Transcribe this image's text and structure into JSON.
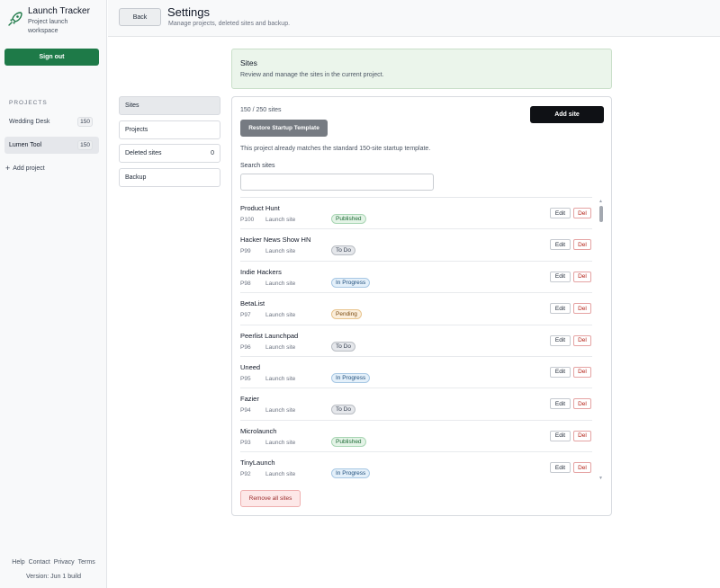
{
  "app": {
    "title": "Launch Tracker",
    "subtitle_line1": "Project launch",
    "subtitle_line2": "workspace",
    "logo_icon": "rocket-icon"
  },
  "sidebar": {
    "signout_label": "Sign out",
    "projects_heading": "PROJECTS",
    "projects": [
      {
        "name": "Wedding Desk",
        "count": "150",
        "active": false
      },
      {
        "name": "Lumen Tool",
        "count": "150",
        "active": true
      }
    ],
    "add_project_label": "Add project",
    "footer_links": [
      "Help",
      "Contact",
      "Privacy",
      "Terms"
    ],
    "version": "Version: Jun 1 build"
  },
  "header": {
    "back_label": "Back",
    "title": "Settings",
    "subtitle": "Manage projects, deleted sites and backup."
  },
  "settings_nav": [
    {
      "label": "Sites",
      "count": "",
      "active": true
    },
    {
      "label": "Projects",
      "count": "",
      "active": false
    },
    {
      "label": "Deleted sites",
      "count": "0",
      "active": false
    },
    {
      "label": "Backup",
      "count": "",
      "active": false
    }
  ],
  "info": {
    "title": "Sites",
    "description": "Review and manage the sites in the current project."
  },
  "panel": {
    "site_count": "150 / 250 sites",
    "restore_label": "Restore Startup Template",
    "add_site_label": "Add site",
    "template_note": "This project already matches the standard 150-site startup template.",
    "search_label": "Search sites",
    "search_value": "",
    "search_placeholder": "",
    "edit_label": "Edit",
    "del_label": "Del",
    "remove_all_label": "Remove all sites"
  },
  "sites": [
    {
      "name": "Product Hunt",
      "code": "P100",
      "type": "Launch site",
      "status": "Published",
      "status_key": "published"
    },
    {
      "name": "Hacker News Show HN",
      "code": "P99",
      "type": "Launch site",
      "status": "To Do",
      "status_key": "todo"
    },
    {
      "name": "Indie Hackers",
      "code": "P98",
      "type": "Launch site",
      "status": "In Progress",
      "status_key": "inprogress"
    },
    {
      "name": "BetaList",
      "code": "P97",
      "type": "Launch site",
      "status": "Pending",
      "status_key": "pending"
    },
    {
      "name": "Peerlist Launchpad",
      "code": "P96",
      "type": "Launch site",
      "status": "To Do",
      "status_key": "todo"
    },
    {
      "name": "Uneed",
      "code": "P95",
      "type": "Launch site",
      "status": "In Progress",
      "status_key": "inprogress"
    },
    {
      "name": "Fazier",
      "code": "P94",
      "type": "Launch site",
      "status": "To Do",
      "status_key": "todo"
    },
    {
      "name": "Microlaunch",
      "code": "P93",
      "type": "Launch site",
      "status": "Published",
      "status_key": "published"
    },
    {
      "name": "TinyLaunch",
      "code": "P92",
      "type": "Launch site",
      "status": "In Progress",
      "status_key": "inprogress"
    }
  ],
  "colors": {
    "signout_bg": "#1e7a48",
    "info_bg": "#ebf5eb",
    "add_site_bg": "#0f1115",
    "restore_bg": "#767b82",
    "remove_all_bg": "#fde8e8"
  }
}
